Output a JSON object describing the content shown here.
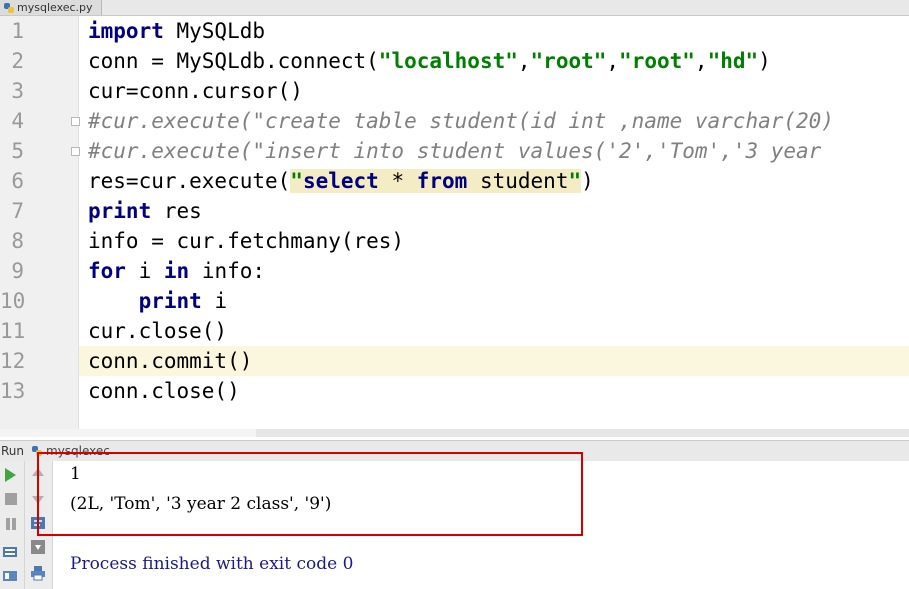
{
  "editor": {
    "tab_title": "mysqlexec.py",
    "line_numbers": [
      "1",
      "2",
      "3",
      "4",
      "5",
      "6",
      "7",
      "8",
      "9",
      "10",
      "11",
      "12",
      "13"
    ],
    "lines": {
      "l1_kw": "import",
      "l1_rest": " MySQLdb",
      "l2_a": "conn = MySQLdb.connect(",
      "l2_s1": "\"localhost\"",
      "l2_c1": ",",
      "l2_s2": "\"root\"",
      "l2_c2": ",",
      "l2_s3": "\"root\"",
      "l2_c3": ",",
      "l2_s4": "\"hd\"",
      "l2_end": ")",
      "l3": "cur=conn.cursor()",
      "l4": "#cur.execute(\"create table student(id int ,name varchar(20)",
      "l5": "#cur.execute(\"insert into student values('2','Tom','3 year",
      "l6_a": "res=cur.execute(",
      "l6_q1": "\"",
      "l6_k1": "select",
      "l6_m": " * ",
      "l6_k2": "from",
      "l6_t": " student",
      "l6_q2": "\"",
      "l6_end": ")",
      "l7_kw": "print",
      "l7_rest": " res",
      "l8": "info = cur.fetchmany(res)",
      "l9_kw1": "for",
      "l9_m": " i ",
      "l9_kw2": "in",
      "l9_rest": " info:",
      "l10_indent": "    ",
      "l10_kw": "print",
      "l10_rest": " i",
      "l11": "cur.close()",
      "l12": "conn.commit()",
      "l13": "conn.close()"
    }
  },
  "run_panel": {
    "label": "Run",
    "config_name": "mysqlexec",
    "output": [
      "1",
      "(2L, 'Tom', '3 year 2 class', '9')"
    ],
    "process_message": "Process finished with exit code 0"
  },
  "colors": {
    "keyword": "#000080",
    "string": "#008000",
    "comment": "#808080",
    "current_line": "#fbf6de",
    "highlight_box": "#d40000"
  }
}
